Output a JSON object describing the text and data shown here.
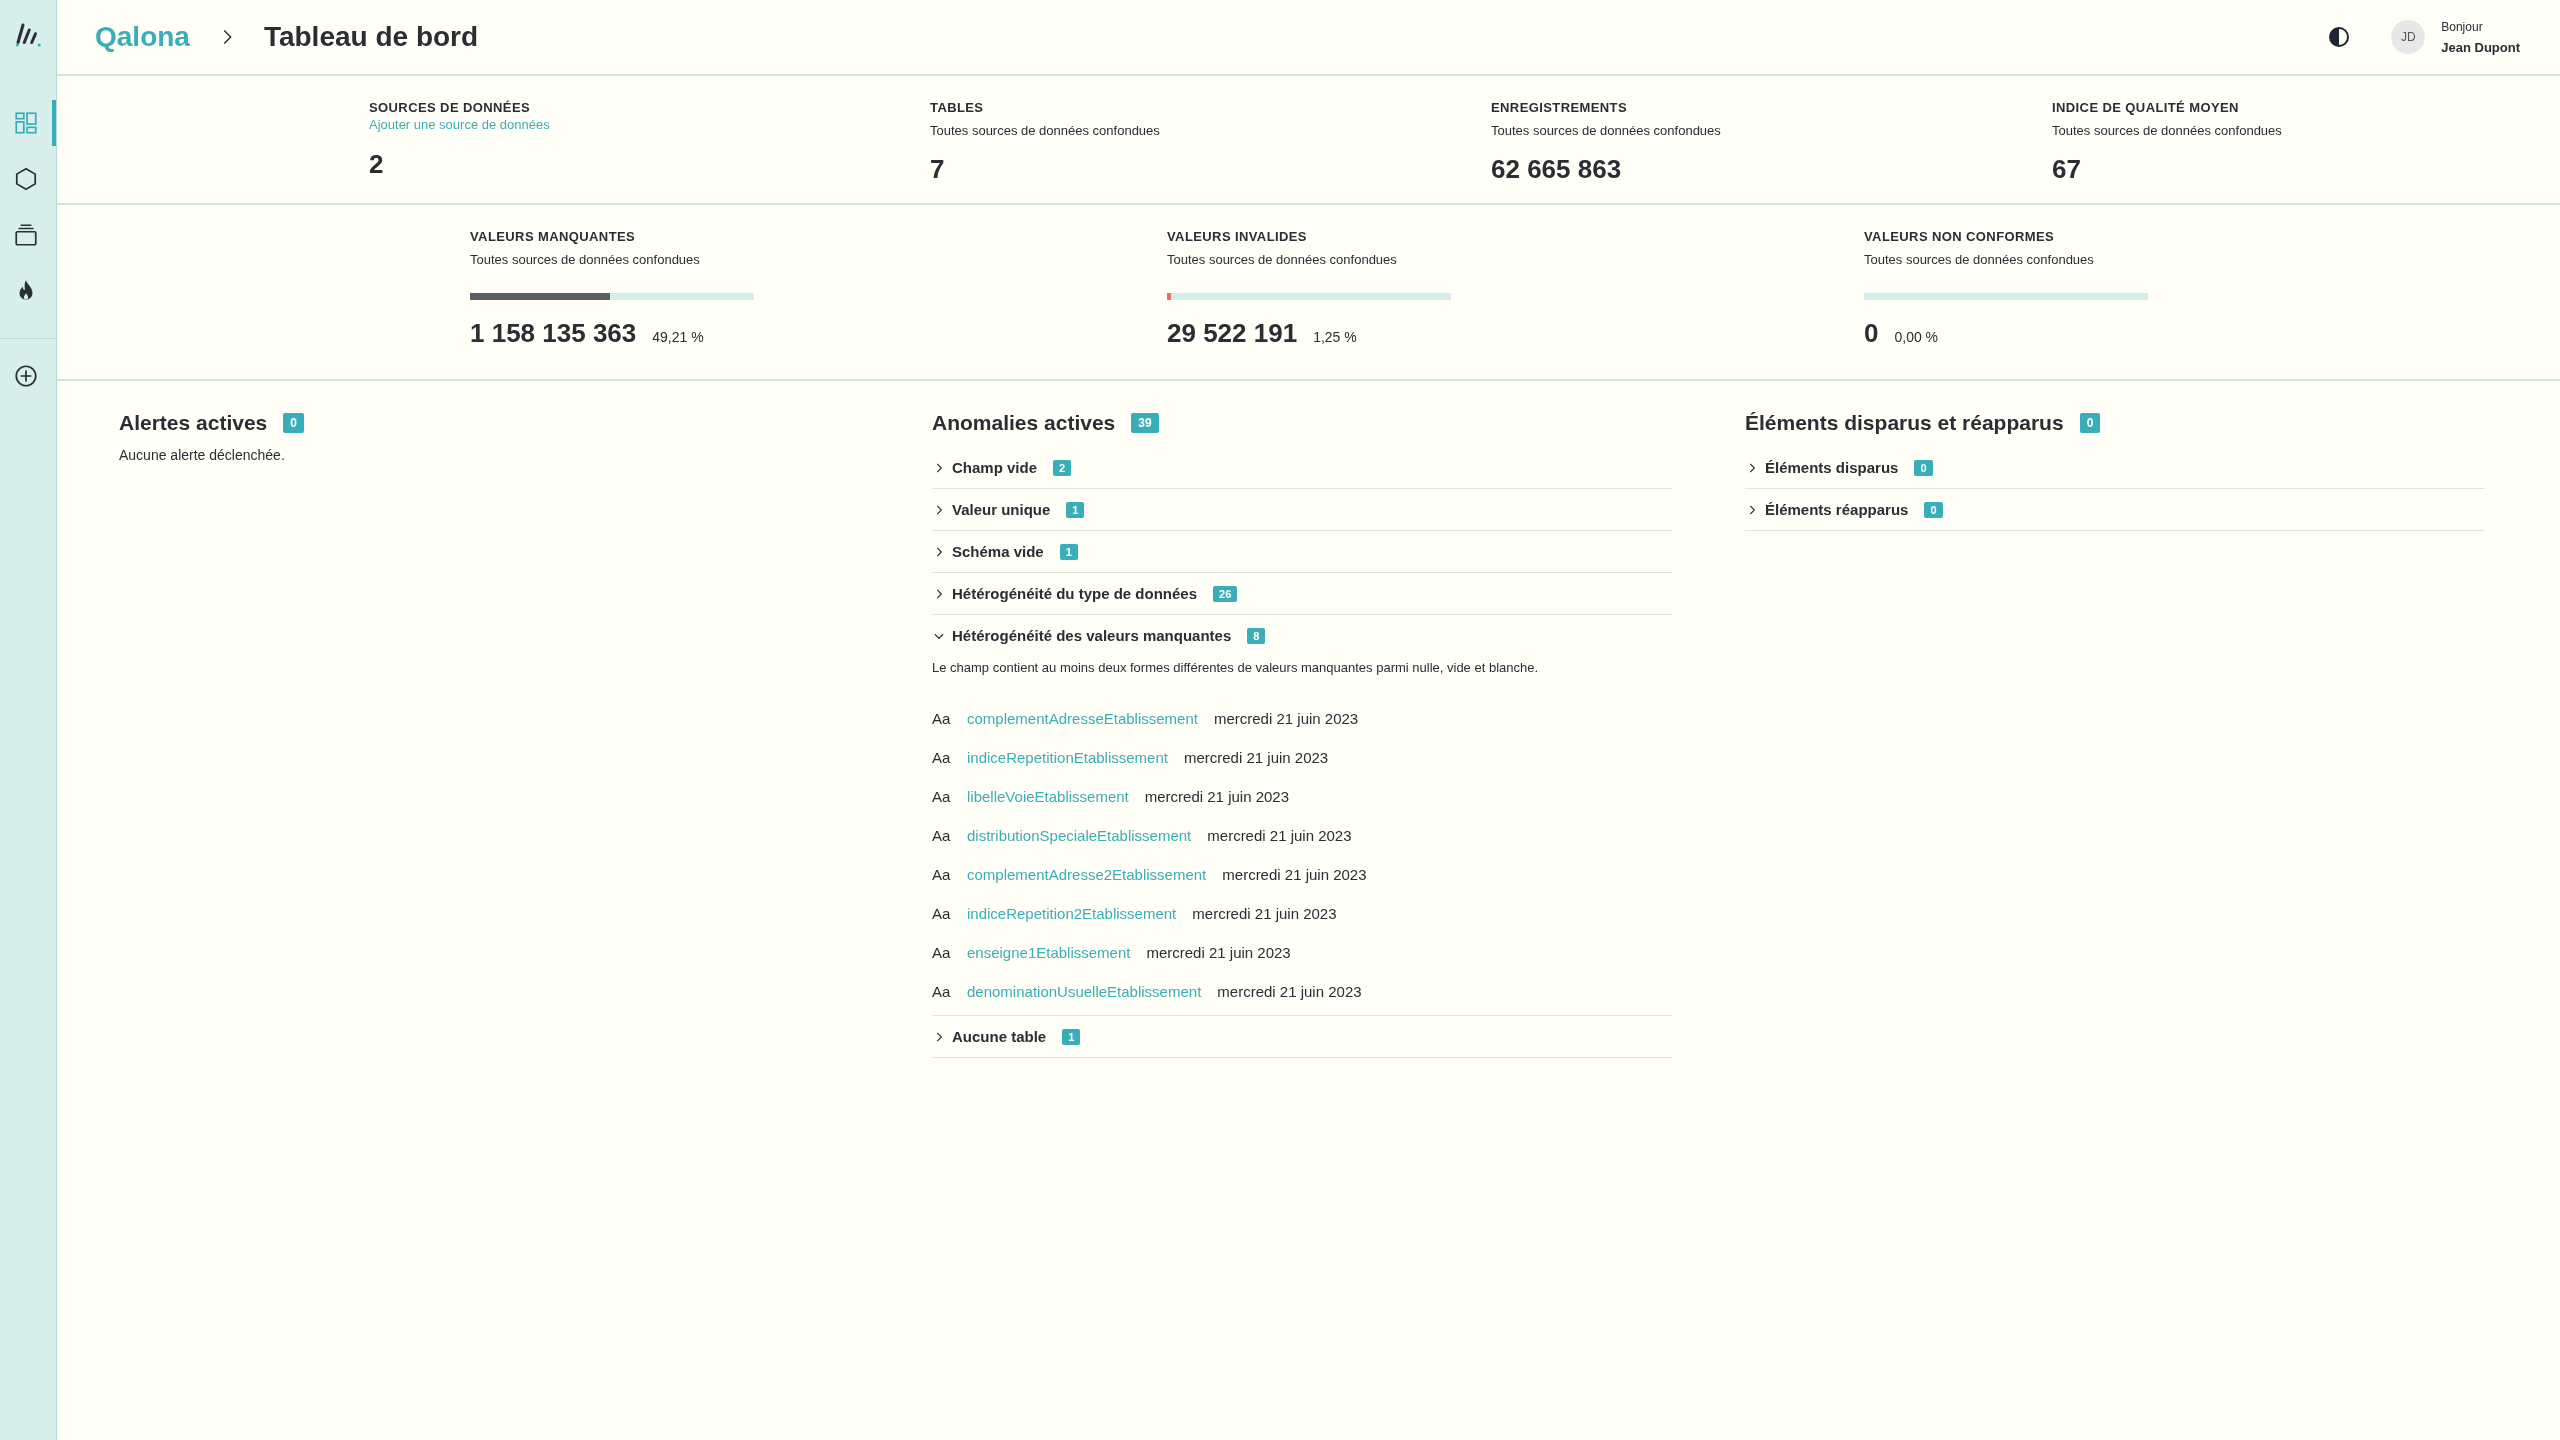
{
  "sidebar": {
    "items": [
      {
        "selected": true
      },
      {
        "selected": false
      },
      {
        "selected": false
      },
      {
        "selected": false
      }
    ]
  },
  "header": {
    "breadcrumb": [
      "Qalona",
      "Tableau de bord"
    ],
    "greeting": "Bonjour",
    "user_name": "Jean Dupont",
    "avatar_initials": "JD"
  },
  "summary": [
    {
      "label": "SOURCES DE DONNÉES",
      "subtitle": "Ajouter une source de données",
      "kind": "link",
      "value": "2"
    },
    {
      "label": "TABLES",
      "subtitle": "Toutes sources de données confondues",
      "kind": "text",
      "value": "7"
    },
    {
      "label": "ENREGISTREMENTS",
      "subtitle": "Toutes sources de données confondues",
      "kind": "text",
      "value": "62 665 863"
    },
    {
      "label": "INDICE DE QUALITÉ MOYEN",
      "subtitle": "Toutes sources de données confondues",
      "kind": "text",
      "value": "67"
    }
  ],
  "quality": [
    {
      "label": "VALEURS MANQUANTES",
      "subtitle": "Toutes sources de données confondues",
      "level": 0.4921,
      "color": "#5a5f66",
      "value": "1 158 135 363",
      "percent": "49,21 %"
    },
    {
      "label": "VALEURS INVALIDES",
      "subtitle": "Toutes sources de données confondues",
      "level": 0.0125,
      "color": "#e8735a",
      "value": "29 522 191",
      "percent": "1,25 %"
    },
    {
      "label": "VALEURS NON CONFORMES",
      "subtitle": "Toutes sources de données confondues",
      "level": 0,
      "value": "0",
      "percent": "0,00 %"
    }
  ],
  "alerts": {
    "title": "Alertes actives",
    "count": "0",
    "empty_text": "Aucune alerte déclenchée."
  },
  "anomalies": {
    "title": "Anomalies actives",
    "count": "39",
    "groups": [
      {
        "label": "Champ vide",
        "count": "2",
        "expanded": false
      },
      {
        "label": "Valeur unique",
        "count": "1",
        "expanded": false
      },
      {
        "label": "Schéma vide",
        "count": "1",
        "expanded": false
      },
      {
        "label": "Hétérogénéité du type de données",
        "count": "26",
        "expanded": false
      },
      {
        "label": "Hétérogénéité des valeurs manquantes",
        "count": "8",
        "expanded": true,
        "description": "Le champ contient au moins deux formes différentes de valeurs manquantes parmi nulle, vide et blanche.",
        "fields": [
          {
            "type_label": "Aa",
            "name": "complementAdresseEtablissement",
            "date": "mercredi 21 juin 2023"
          },
          {
            "type_label": "Aa",
            "name": "indiceRepetitionEtablissement",
            "date": "mercredi 21 juin 2023"
          },
          {
            "type_label": "Aa",
            "name": "libelleVoieEtablissement",
            "date": "mercredi 21 juin 2023"
          },
          {
            "type_label": "Aa",
            "name": "distributionSpecialeEtablissement",
            "date": "mercredi 21 juin 2023"
          },
          {
            "type_label": "Aa",
            "name": "complementAdresse2Etablissement",
            "date": "mercredi 21 juin 2023"
          },
          {
            "type_label": "Aa",
            "name": "indiceRepetition2Etablissement",
            "date": "mercredi 21 juin 2023"
          },
          {
            "type_label": "Aa",
            "name": "enseigne1Etablissement",
            "date": "mercredi 21 juin 2023"
          },
          {
            "type_label": "Aa",
            "name": "denominationUsuelleEtablissement",
            "date": "mercredi 21 juin 2023"
          }
        ]
      },
      {
        "label": "Aucune table",
        "count": "1",
        "expanded": false
      }
    ]
  },
  "changes": {
    "title": "Éléments disparus et réapparus",
    "count": "0",
    "groups": [
      {
        "label": "Éléments disparus",
        "count": "0",
        "expanded": false
      },
      {
        "label": "Éléments réapparus",
        "count": "0",
        "expanded": false
      }
    ]
  }
}
